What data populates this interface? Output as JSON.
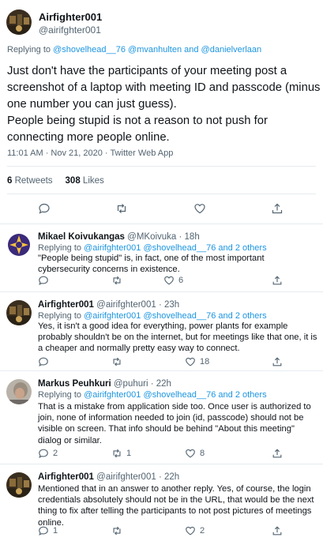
{
  "main": {
    "author_name": "Airfighter001",
    "author_handle": "@airifghter001",
    "replying_prefix": "Replying to ",
    "replying_handles": "@shovelhead__76 @mvanhulten and @danielverlaan",
    "body": "Just don't have the participants of your meeting post a screenshot of a laptop with meeting ID and passcode (minus one number you can just guess).\nPeople being stupid is not a reason to not push for connecting more people online.",
    "meta": "11:01 AM · Nov 21, 2020 · Twitter Web App",
    "retweets_count": "6",
    "retweets_label": "Retweets",
    "likes_count": "308",
    "likes_label": "Likes",
    "icons": [
      "reply-icon",
      "retweet-icon",
      "like-icon",
      "share-icon"
    ]
  },
  "replies": [
    {
      "name": "Mikael Koivukangas",
      "handle": "@MKoivuka",
      "time": "· 18h",
      "replying_prefix": "Replying to ",
      "replying_handles": "@airifghter001 @shovelhead__76 and 2 others",
      "text": "\"People being stupid\" is, in fact, one of the most important cybersecurity concerns in existence.",
      "reply_count": "",
      "retweet_count": "",
      "like_count": "6"
    },
    {
      "name": "Airfighter001",
      "handle": "@airifghter001",
      "time": "· 23h",
      "replying_prefix": "Replying to ",
      "replying_handles": "@airifghter001 @shovelhead__76 and 2 others",
      "text": "Yes, it isn't a good idea for everything, power plants for example probably shouldn't be on the internet, but for meetings like that one, it is a cheaper and normally pretty easy way to connect.",
      "reply_count": "",
      "retweet_count": "",
      "like_count": "18"
    },
    {
      "name": "Markus Peuhkuri",
      "handle": "@puhuri",
      "time": "· 22h",
      "replying_prefix": "Replying to ",
      "replying_handles": "@airifghter001 @shovelhead__76 and 2 others",
      "text": "That is a mistake from application side too. Once user is authorized to join, none of information needed to join (id, passcode) should not be visible on screen. That info should be behind \"About this meeting\" dialog or similar.",
      "reply_count": "2",
      "retweet_count": "1",
      "like_count": "8"
    },
    {
      "name": "Airfighter001",
      "handle": "@airifghter001",
      "time": "· 22h",
      "replying_prefix": "",
      "replying_handles": "",
      "text": "Mentioned that in an answer to another reply. Yes, of course, the login credentials absolutely should not be in the URL, that would be the next thing to fix after telling the participants to not post pictures of meetings online.",
      "reply_count": "1",
      "retweet_count": "",
      "like_count": "2"
    }
  ],
  "colors": {
    "link": "#1b95e0",
    "muted": "#536471",
    "text": "#0f1419",
    "divider": "#e6ecf0"
  }
}
